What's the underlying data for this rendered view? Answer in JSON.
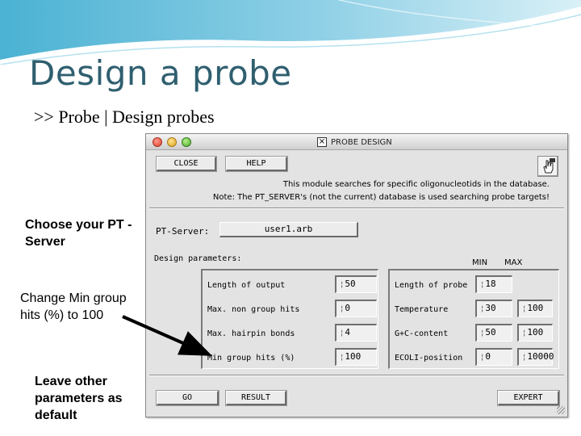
{
  "slide": {
    "title": "Design a probe",
    "subtitle": ">> Probe | Design probes",
    "notes": [
      "Choose your PT -Server",
      "Change Min group hits (%) to 100",
      "Leave other parameters as default"
    ]
  },
  "window": {
    "title": "PROBE DESIGN",
    "buttons": {
      "close": "CLOSE",
      "help": "HELP",
      "go": "GO",
      "result": "RESULT",
      "expert": "EXPERT"
    },
    "info_lines": [
      "This module searches for specific oligonucleotids in the database.",
      "Note: The PT_SERVER's (not the current) database is used searching probe targets!"
    ],
    "pt_server": {
      "label": "PT-Server:",
      "value": "user1.arb"
    },
    "design_parameters_label": "Design parameters:",
    "column_headers": {
      "min": "MIN",
      "max": "MAX"
    },
    "left_params": [
      {
        "label": "Length of output",
        "value": "50"
      },
      {
        "label": "Max. non group hits",
        "value": "0"
      },
      {
        "label": "Max. hairpin bonds",
        "value": "4"
      },
      {
        "label": "Min group hits (%)",
        "value": "100"
      }
    ],
    "right_params": [
      {
        "label": "Length of probe",
        "min": "18",
        "max": ""
      },
      {
        "label": "Temperature",
        "min": "30",
        "max": "100"
      },
      {
        "label": "G+C-content",
        "min": "50",
        "max": "100"
      },
      {
        "label": "ECOLI-position",
        "min": "0",
        "max": "10000"
      }
    ]
  },
  "colors": {
    "title_color": "#2f5f6f",
    "header_wave": "#3fa6c8",
    "window_bg": "#e3e3e3"
  }
}
